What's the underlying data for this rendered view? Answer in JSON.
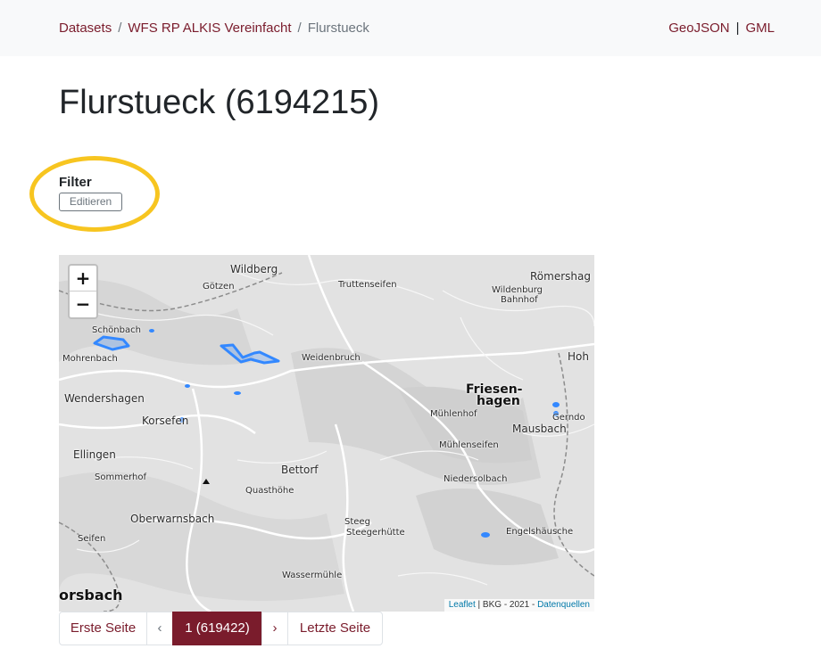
{
  "breadcrumb": {
    "items": [
      "Datasets",
      "WFS RP ALKIS Vereinfacht"
    ],
    "current": "Flurstueck",
    "separator": "/"
  },
  "formats": {
    "geojson": "GeoJSON",
    "separator": "|",
    "gml": "GML"
  },
  "page_title": "Flurstueck (6194215)",
  "filter": {
    "label": "Filter",
    "edit_button": "Editieren"
  },
  "map": {
    "zoom_in": "+",
    "zoom_out": "−",
    "places": [
      "Wildberg",
      "Götzen",
      "Truttenseifen",
      "Römershag",
      "Wildenburg",
      "Bahnhof",
      "Schönbach",
      "Mohrenbach",
      "Weidenbruch",
      "Hoh",
      "Wendershagen",
      "Friesen-",
      "hagen",
      "Mühlenhof",
      "Gerndo",
      "Mausbach",
      "Korsefen",
      "Mühlenseifen",
      "Ellingen",
      "Bettorf",
      "Sommerhof",
      "Niedersolbach",
      "Quasthöhe",
      "Oberwarnsbach",
      "Steeg",
      "Steegerhütte",
      "Seifen",
      "Engelshäusche",
      "Wassermühle",
      "orsbach"
    ],
    "attribution": {
      "leaflet": "Leaflet",
      "text": " | BKG - 2021 - ",
      "sources": "Datenquellen"
    },
    "feature_color": "#3388ff"
  },
  "pagination": {
    "first": "Erste Seite",
    "prev": "‹",
    "current": "1 (619422)",
    "next": "›",
    "last": "Letzte Seite"
  },
  "colors": {
    "accent": "#7a1c2c",
    "highlight": "#f7c520",
    "navbar": "#f8f9fa"
  }
}
